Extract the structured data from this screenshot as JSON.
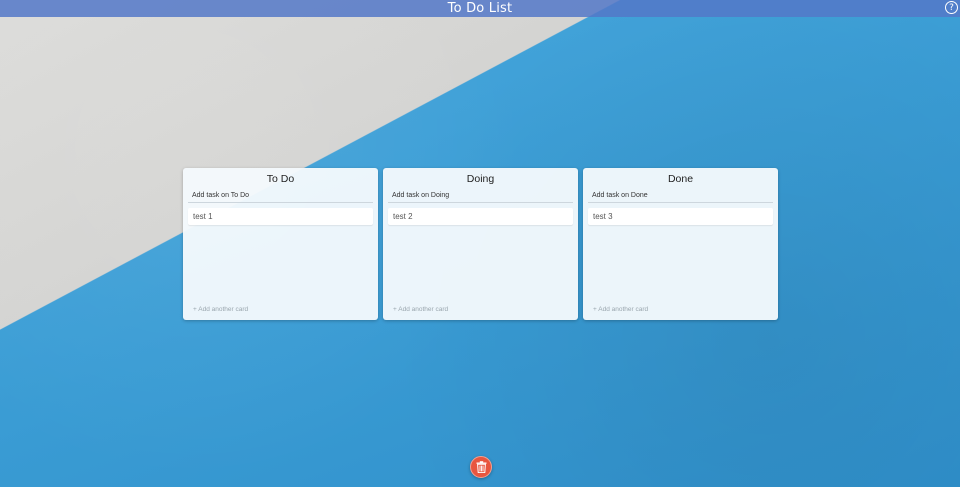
{
  "app": {
    "title": "To Do List",
    "help_icon": "?"
  },
  "columns": [
    {
      "title": "To Do",
      "add_task_placeholder": "Add task on To Do",
      "cards": [
        "test 1"
      ],
      "add_card_label": "+ Add another card"
    },
    {
      "title": "Doing",
      "add_task_placeholder": "Add task on Doing",
      "cards": [
        "test 2"
      ],
      "add_card_label": "+ Add another card"
    },
    {
      "title": "Done",
      "add_task_placeholder": "Add task on Done",
      "cards": [
        "test 3"
      ],
      "add_card_label": "+ Add another card"
    }
  ],
  "icons": {
    "help": "help-icon",
    "trash": "trash-icon"
  },
  "colors": {
    "topbar": "#5478c8",
    "trash_button": "#e8563f",
    "wall_blue": "#3a9cd4",
    "wall_grey": "#d6d6d4"
  }
}
